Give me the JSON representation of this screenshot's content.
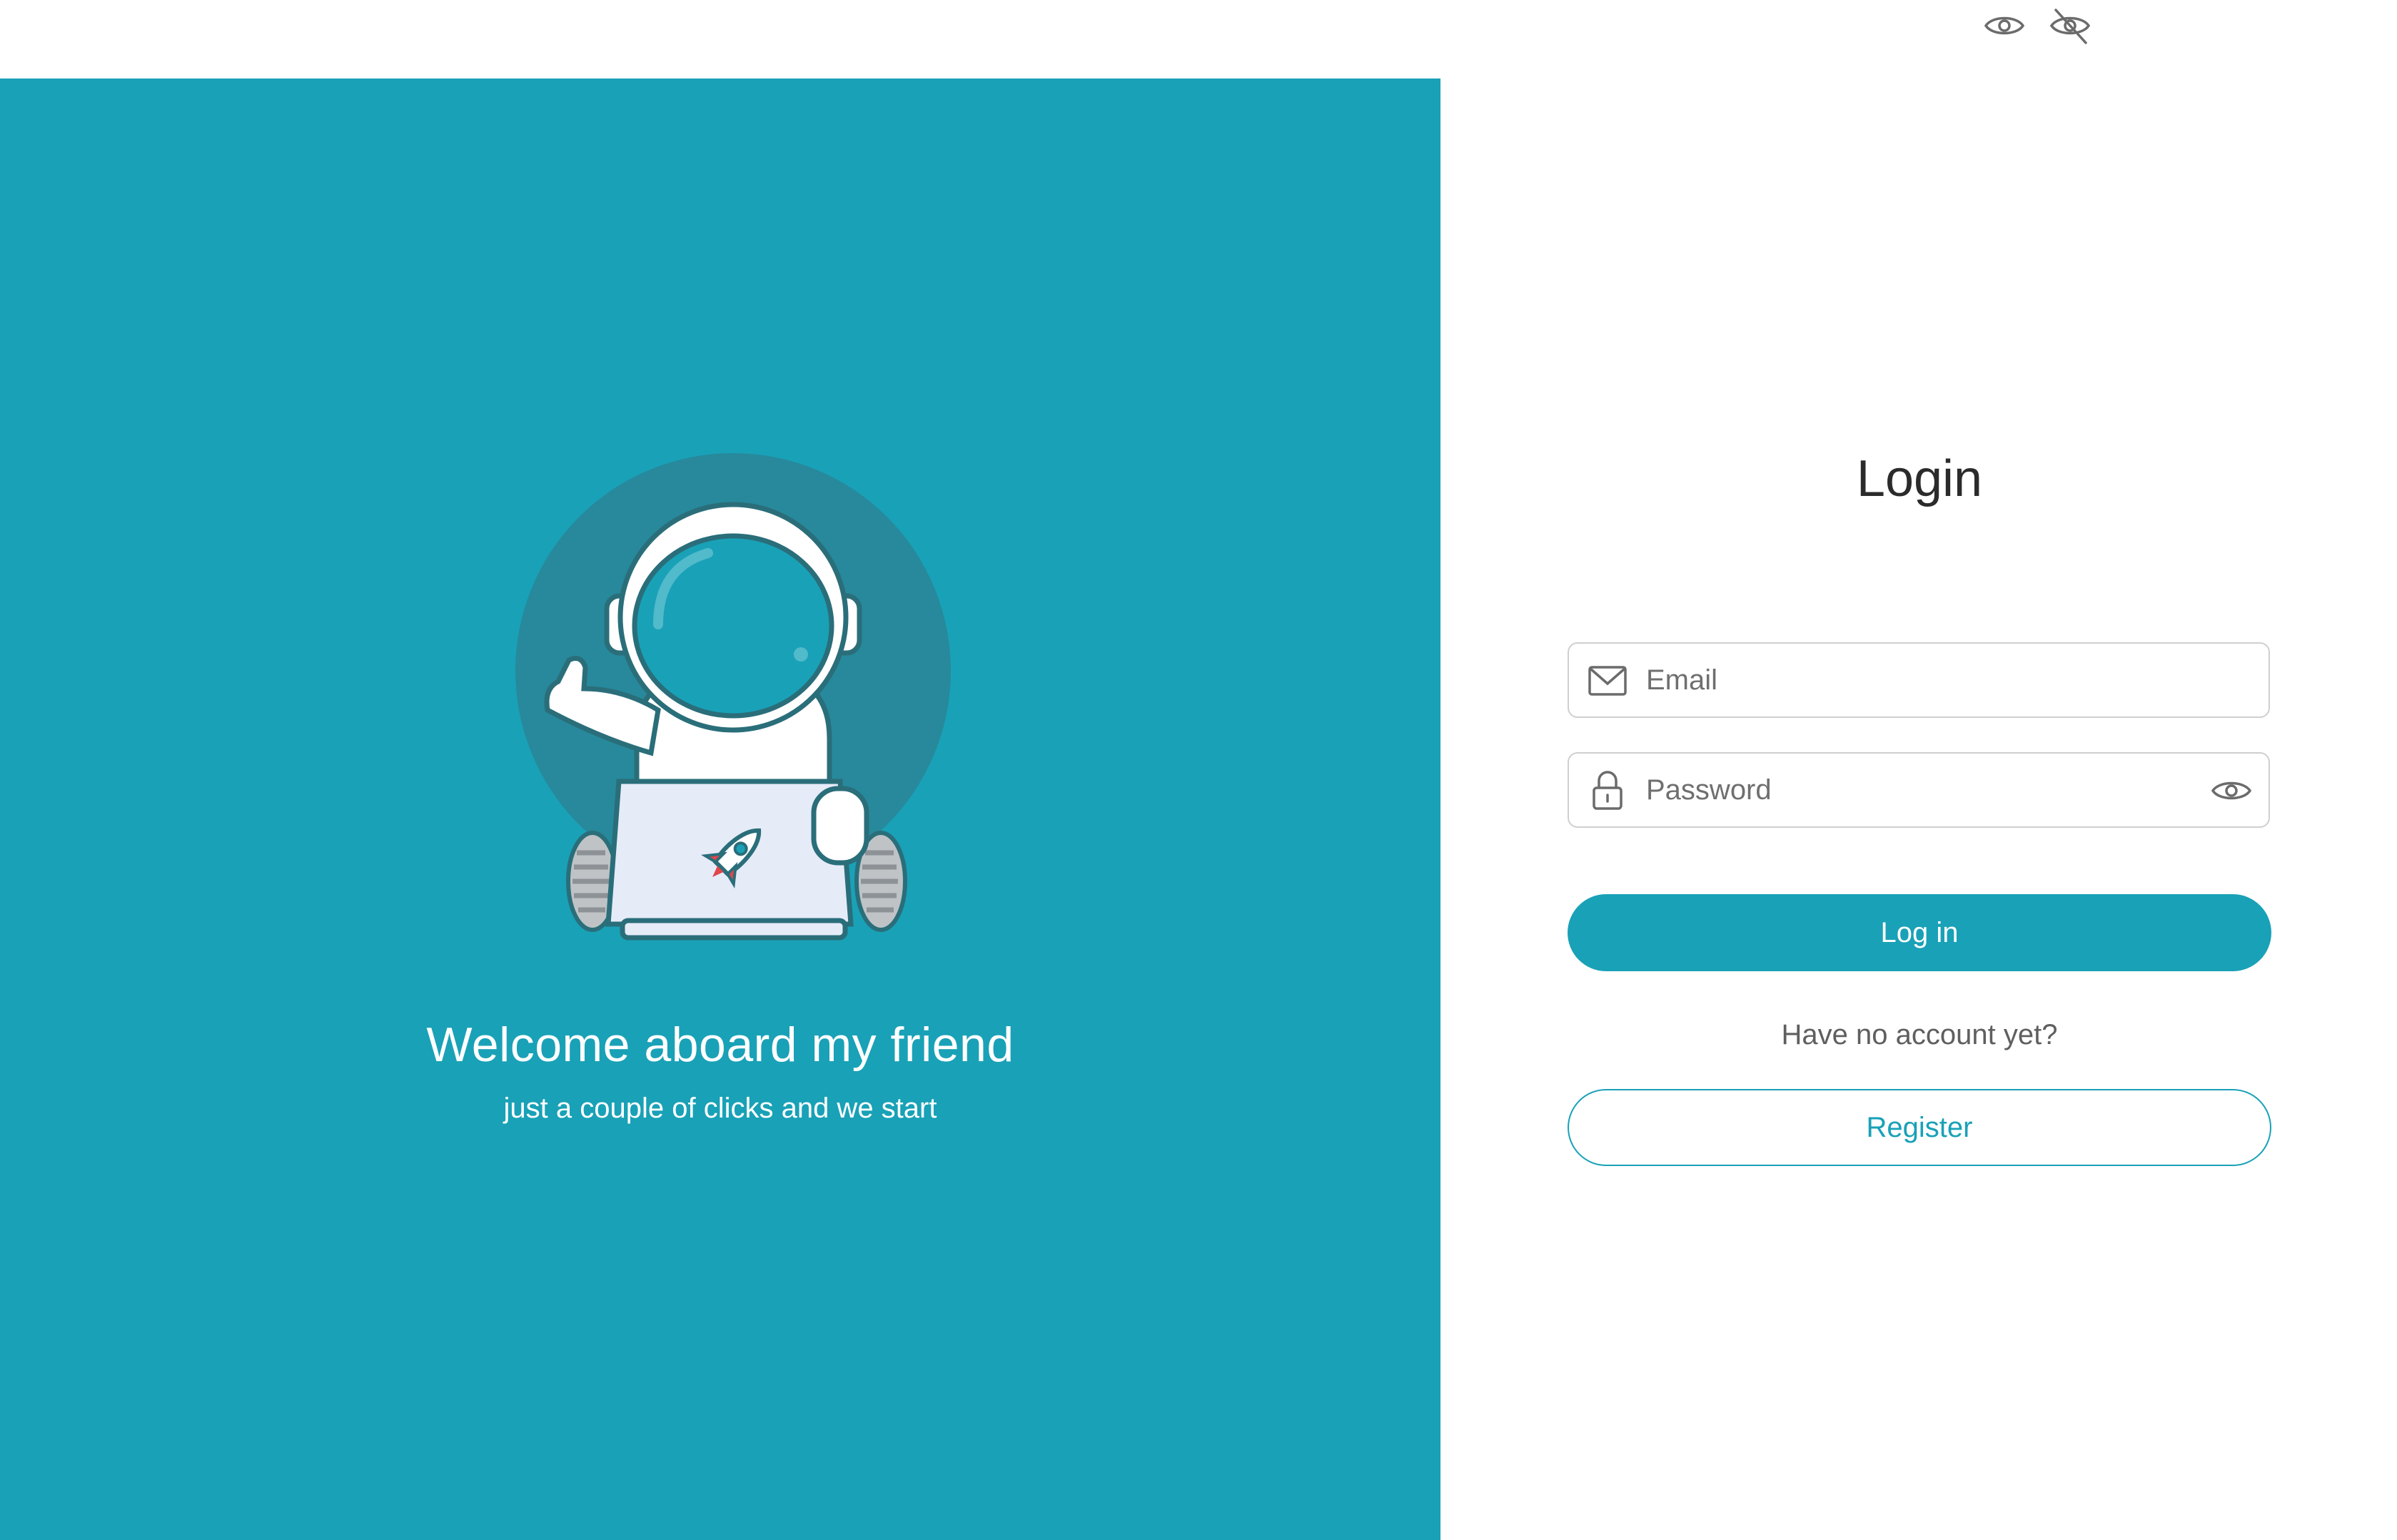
{
  "top_icons": {
    "show_icon": "eye-icon",
    "hide_icon": "eye-off-icon"
  },
  "welcome": {
    "title": "Welcome aboard my friend",
    "subtitle": "just a couple of clicks and we start",
    "illustration": "astronaut-with-laptop"
  },
  "login_form": {
    "title": "Login",
    "email": {
      "value": "",
      "placeholder": "Email",
      "icon": "envelope-icon"
    },
    "password": {
      "value": "",
      "placeholder": "Password",
      "icon": "lock-icon",
      "toggle_icon": "eye-icon"
    },
    "login_label": "Log in",
    "no_account_text": "Have no account yet?",
    "register_label": "Register"
  },
  "colors": {
    "accent": "#19a1b7",
    "circle": "#27899b",
    "text_dark": "#2b2b2b",
    "text_muted": "#5f5f5f",
    "border": "#cfcfcf"
  }
}
